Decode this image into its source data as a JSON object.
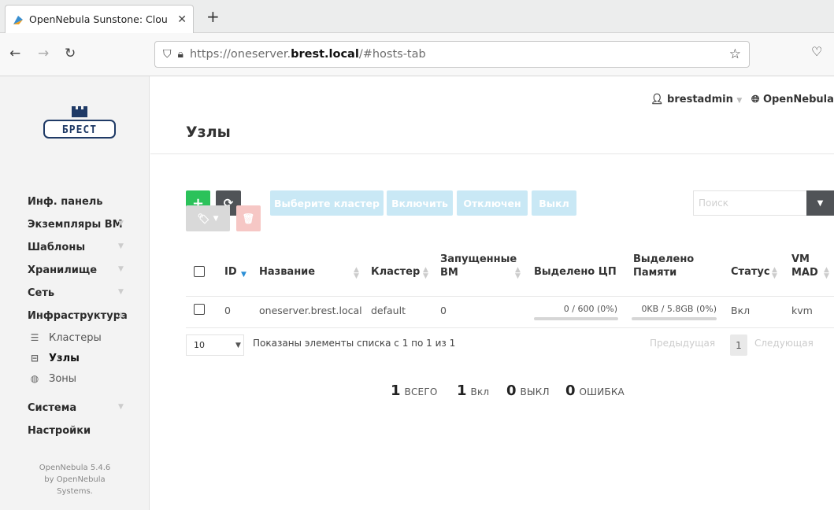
{
  "browser": {
    "tab_title": "OpenNebula Sunstone: Clou",
    "url_prefix": "https://oneserver.",
    "url_domain": "brest.local",
    "url_suffix": "/#hosts-tab"
  },
  "header": {
    "user": "brestadmin",
    "zone": "OpenNebula",
    "page_title": "Узлы"
  },
  "logo_text": "БРЕСТ",
  "sidebar": {
    "items": [
      {
        "label": "Инф. панель"
      },
      {
        "label": "Экземпляры ВМ"
      },
      {
        "label": "Шаблоны"
      },
      {
        "label": "Хранилище"
      },
      {
        "label": "Сеть"
      },
      {
        "label": "Инфраструктура"
      },
      {
        "label": "Кластеры"
      },
      {
        "label": "Узлы"
      },
      {
        "label": "Зоны"
      },
      {
        "label": "Система"
      },
      {
        "label": "Настройки"
      }
    ],
    "version_line1": "OpenNebula 5.4.6",
    "version_line2": "by OpenNebula",
    "version_line3": "Systems."
  },
  "toolbar": {
    "add_label": "+",
    "select_cluster": "Выберите кластер",
    "enable": "Включить",
    "disable": "Отключен",
    "off": "Выкл",
    "search_placeholder": "Поиск"
  },
  "table": {
    "columns": {
      "id": "ID",
      "name": "Название",
      "cluster": "Кластер",
      "running_vms_1": "Запущенные",
      "running_vms_2": "ВМ",
      "alloc_cpu": "Выделено ЦП",
      "alloc_mem_1": "Выделено",
      "alloc_mem_2": "Памяти",
      "status": "Статус",
      "vm_mad_1": "VM",
      "vm_mad_2": "MAD"
    },
    "rows": [
      {
        "id": "0",
        "name": "oneserver.brest.local",
        "cluster": "default",
        "running_vms": "0",
        "cpu_text": "0 / 600 (0%)",
        "cpu_fraction": 0,
        "mem_text": "0KB / 5.8GB (0%)",
        "mem_fraction": 0,
        "status": "Вкл",
        "vm_mad": "kvm"
      }
    ]
  },
  "footer": {
    "page_size": "10",
    "showing": "Показаны элементы списка с 1 по 1 из 1",
    "prev": "Предыдущая",
    "current_page": "1",
    "next": "Следующая"
  },
  "summary": {
    "total_n": "1",
    "total_l": "всего",
    "on_n": "1",
    "on_l": "Вкл",
    "off_n": "0",
    "off_l": "выкл",
    "error_n": "0",
    "error_l": "ошибка"
  },
  "colors": {
    "add": "#2bc25a",
    "refresh": "#505357",
    "disabled_action": "#c9e8f5",
    "delete": "#f6c7c5",
    "sort_active": "#2c8fd6"
  }
}
